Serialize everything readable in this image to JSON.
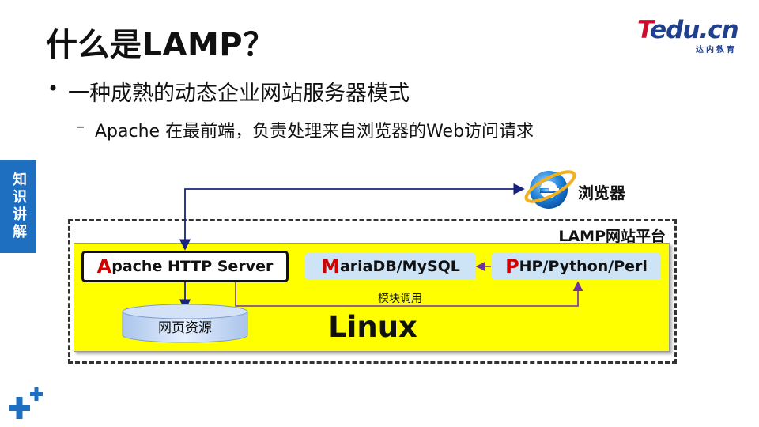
{
  "slide": {
    "title": "什么是LAMP？",
    "bullet1": "一种成熟的动态企业网站服务器模式",
    "bullet2_dash": "–",
    "bullet2": "Apache 在最前端，负责处理来自浏览器的Web访问请求",
    "side_tab": "知识讲解"
  },
  "logo": {
    "brand_first": "T",
    "brand_rest": "edu.cn",
    "subtitle": "达内教育"
  },
  "diagram": {
    "browser_label": "浏览器",
    "platform_label": "LAMP网站平台",
    "apache_first": "A",
    "apache_rest": "pache HTTP Server",
    "maria_first": "M",
    "maria_rest": "ariaDB/MySQL",
    "php_first": "P",
    "php_rest": "HP/Python/Perl",
    "module_call_label": "模块调用",
    "web_resources_label": "网页资源",
    "os_label": "Linux"
  },
  "colors": {
    "accent_blue": "#1f6fc1",
    "platform_yellow": "#ffff00",
    "component_box": "#cde3f6",
    "initial_red": "#d00000",
    "arrow_navy": "#1a237e",
    "arrow_purple": "#7030a0"
  }
}
